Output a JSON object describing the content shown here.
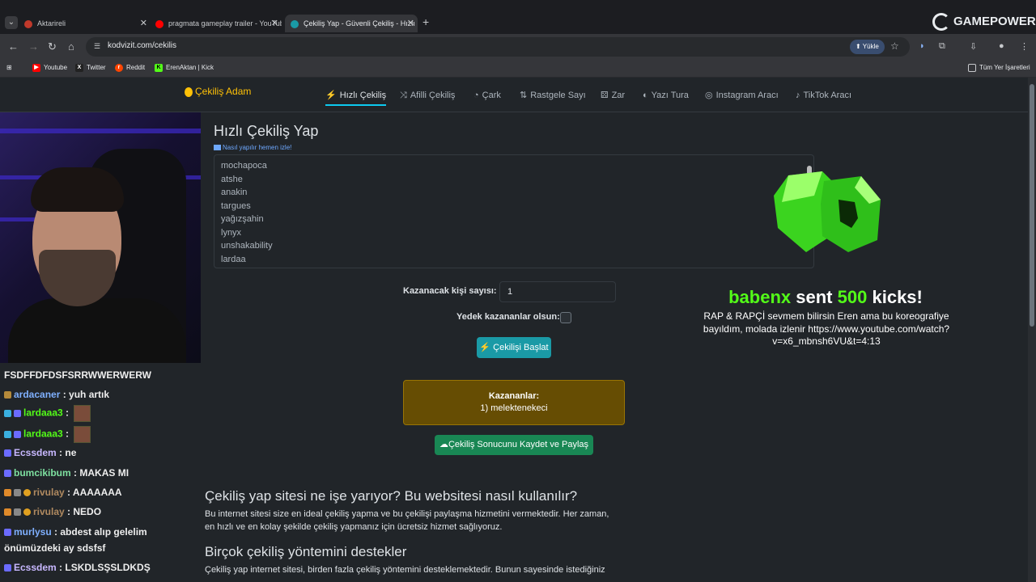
{
  "browser": {
    "tabs": [
      {
        "label": "Aktarireli",
        "favicon_color": "#c0392b"
      },
      {
        "label": "pragmata gameplay trailer - YouTube",
        "favicon_color": "#ff0000"
      },
      {
        "label": "Çekiliş Yap - Güvenli Çekiliş - Hızlı",
        "favicon_color": "#1a9aa6"
      }
    ],
    "new_tab": "+",
    "overlay_logo": "GAMEPOWER",
    "url": "kodvizit.com/cekilis",
    "upload_label": "Yükle",
    "bookmarks": [
      {
        "label": "Youtube",
        "color": "#ff0000",
        "icon": "youtube-icon"
      },
      {
        "label": "Twitter",
        "color": "#222",
        "icon": "x-icon"
      },
      {
        "label": "Reddit",
        "color": "#ff4500",
        "icon": "reddit-icon"
      },
      {
        "label": "ErenAktan | Kick",
        "color": "#53fc18",
        "icon": "kick-icon"
      }
    ],
    "all_bookmarks": "Tüm Yer İşaretleri"
  },
  "site": {
    "brand": "Çekiliş Adam",
    "nav": [
      {
        "label": "Hızlı Çekiliş",
        "icon": "bolt-icon",
        "glyph": "⚡",
        "active": true
      },
      {
        "label": "Afilli Çekiliş",
        "icon": "shuffle-icon",
        "glyph": "⤨",
        "active": false
      },
      {
        "label": "Çark",
        "icon": "pie-icon",
        "glyph": "◔",
        "active": false
      },
      {
        "label": "Rastgele Sayı",
        "icon": "sort-icon",
        "glyph": "⇅",
        "active": false
      },
      {
        "label": "Zar",
        "icon": "dice-icon",
        "glyph": "⚄",
        "active": false
      },
      {
        "label": "Yazı Tura",
        "icon": "coin-icon",
        "glyph": "◐",
        "active": false
      },
      {
        "label": "Instagram Aracı",
        "icon": "instagram-icon",
        "glyph": "◎",
        "active": false
      },
      {
        "label": "TikTok Aracı",
        "icon": "tiktok-icon",
        "glyph": "♪",
        "active": false
      }
    ],
    "page_title": "Hızlı Çekiliş Yap",
    "how_link": "Nasıl yapılır hemen izle!",
    "participants": [
      "mochapoca",
      "atshe",
      "anakin",
      "targues",
      "yağızşahin",
      "lynyx",
      "unshakability",
      "lardaa"
    ],
    "winner_count_label": "Kazanacak kişi sayısı:",
    "winner_count_value": "1",
    "backup_label": "Yedek kazananlar olsun:",
    "start_button": "Çekilişi Başlat",
    "winners_title": "Kazananlar:",
    "winners_list": "1) melektenekeci",
    "save_button": "Çekiliş Sonucunu Kaydet ve Paylaş",
    "section1_title": "Çekiliş yap sitesi ne işe yarıyor? Bu websitesi nasıl kullanılır?",
    "section1_text": "Bu internet sitesi size en ideal çekiliş yapma ve bu çekilişi paylaşma hizmetini vermektedir. Her zaman, en hızlı ve en kolay şekilde çekiliş yapmanız için ücretsiz hizmet sağlıyoruz.",
    "section2_title": "Birçok çekiliş yöntemini destekler",
    "section2_text": "Çekiliş yap internet sitesi, birden fazla çekiliş yöntemini desteklemektedir. Bunun sayesinde istediğiniz"
  },
  "stream": {
    "chat": [
      {
        "user": "",
        "text": "FSDFFDFDSFSRRWWERWERW",
        "color": "#eeeeee",
        "badges": [],
        "emote": false
      },
      {
        "user": "ardacaner",
        "text": "yuh artık",
        "color": "#7fb0ff",
        "badges": [
          "#b58a3a"
        ],
        "emote": false
      },
      {
        "user": "lardaaa3",
        "text": "",
        "color": "#53fc18",
        "badges": [
          "#3ab0e0",
          "#6b6bff"
        ],
        "emote": true
      },
      {
        "user": "lardaaa3",
        "text": "",
        "color": "#53fc18",
        "badges": [
          "#3ab0e0",
          "#6b6bff"
        ],
        "emote": true
      },
      {
        "user": "Ecssdem",
        "text": "ne",
        "color": "#c8b8ff",
        "badges": [
          "#6b6bff"
        ],
        "emote": false
      },
      {
        "user": "bumcikibum",
        "text": "MAKAS MI",
        "color": "#7ee0a0",
        "badges": [
          "#6b6bff"
        ],
        "emote": false
      },
      {
        "user": "rivulay",
        "text": "AAAAAAA",
        "color": "#b08a60",
        "badges": [
          "#e08a2a",
          "#888",
          "#e0a020"
        ],
        "emote": false
      },
      {
        "user": "rivulay",
        "text": "NEDO",
        "color": "#b08a60",
        "badges": [
          "#e08a2a",
          "#888",
          "#e0a020"
        ],
        "emote": false
      },
      {
        "user": "murlysu",
        "text": "abdest alıp gelelim",
        "color": "#7fb0ff",
        "badges": [
          "#6b6bff"
        ],
        "emote": false
      },
      {
        "user": "",
        "text": "önümüzdeki ay sdsfsf",
        "color": "#eeeeee",
        "badges": [],
        "emote": false
      },
      {
        "user": "Ecssdem",
        "text": "LSKDLSŞSLDKDŞ",
        "color": "#c8b8ff",
        "badges": [
          "#6b6bff"
        ],
        "emote": false
      }
    ],
    "alert": {
      "user": "babenx",
      "mid": "sent",
      "amount": "500",
      "suffix": "kicks!",
      "message": "RAP & RAPÇİ sevmem bilirsin Eren ama bu koreografiye bayıldım, molada izlenir https://www.youtube.com/watch?v=x6_mbnsh6VU&t=4:13"
    }
  }
}
